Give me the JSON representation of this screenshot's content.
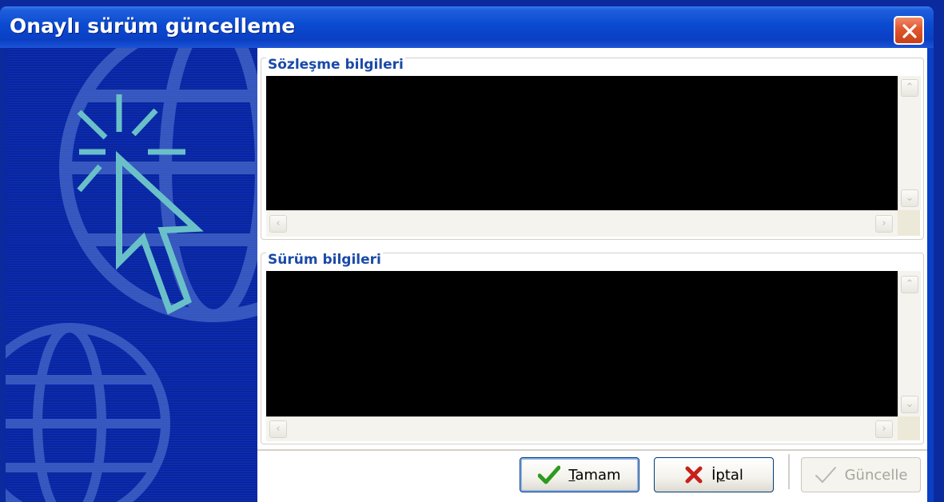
{
  "window": {
    "title": "Onaylı sürüm güncelleme",
    "close_icon": "close-icon"
  },
  "banner": {
    "icon": "globe-cursor-illustration"
  },
  "contract_group": {
    "label": "Sözleşme bilgileri"
  },
  "version_group": {
    "label": "Sürüm bilgileri"
  },
  "buttons": {
    "ok": {
      "accel": "T",
      "rest": "amam",
      "icon": "check-icon"
    },
    "cancel": {
      "pre": "İ",
      "accel": "p",
      "rest": "tal",
      "icon": "x-icon"
    },
    "update": {
      "label": "Güncelle",
      "icon": "check-outline-icon",
      "enabled": false
    }
  },
  "colors": {
    "titlebar": "#0a4ad0",
    "banner": "#0b2bb0",
    "group_label": "#1a4aa8",
    "memo_bg": "#000000",
    "check_green": "#2e9a1e",
    "x_red": "#c8201a"
  }
}
